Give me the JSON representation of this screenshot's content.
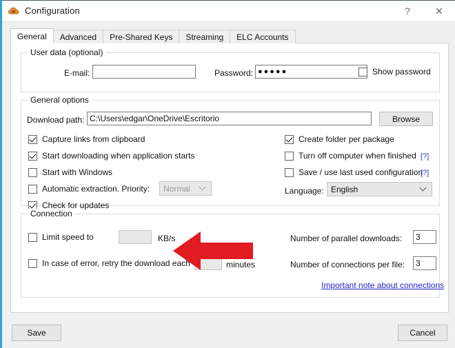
{
  "window": {
    "title": "Configuration",
    "icon": "cloud-icon",
    "accent_border": "#2fa4d8",
    "caption": {
      "help_label": "?",
      "close_label": "✕"
    }
  },
  "tabs": [
    {
      "label": "General",
      "active": true
    },
    {
      "label": "Advanced",
      "active": false
    },
    {
      "label": "Pre-Shared Keys",
      "active": false
    },
    {
      "label": "Streaming",
      "active": false
    },
    {
      "label": "ELC Accounts",
      "active": false
    }
  ],
  "user_data": {
    "group_title": "User data (optional)",
    "email_label": "E-mail:",
    "email_value": "",
    "email_placeholder": "",
    "password_label": "Password:",
    "password_value": "●●●●●",
    "show_password_label": "Show password",
    "show_password_checked": false
  },
  "general_options": {
    "group_title": "General options",
    "download_path_label": "Download path:",
    "download_path_value": "C:\\Users\\edgar\\OneDrive\\Escritorio",
    "browse_label": "Browse",
    "left_checkboxes": [
      {
        "label": "Capture links from clipboard",
        "checked": true
      },
      {
        "label": "Start downloading when application starts",
        "checked": true
      },
      {
        "label": "Start with Windows",
        "checked": false
      },
      {
        "label": "Automatic extraction. Priority:",
        "checked": false
      },
      {
        "label": "Check for updates",
        "checked": true
      }
    ],
    "priority_value": "Normal",
    "priority_disabled": true,
    "right_checkboxes": [
      {
        "label": "Create folder per package",
        "checked": true,
        "help": ""
      },
      {
        "label": "Turn off computer when finished",
        "checked": false,
        "help": "[?]"
      },
      {
        "label": "Save / use last used configuration",
        "checked": false,
        "help": "[?]"
      }
    ],
    "language_label": "Language:",
    "language_value": "English"
  },
  "connection": {
    "group_title": "Connection",
    "limit_speed_label": "Limit speed to",
    "limit_speed_checked": false,
    "limit_speed_value": "",
    "speed_unit": "KB/s",
    "retry_label": "In case of error, retry the download each",
    "retry_checked": false,
    "retry_value": "",
    "retry_unit": "minutes",
    "parallel_downloads_label": "Number of parallel downloads:",
    "parallel_downloads_value": "3",
    "connections_per_file_label": "Number of connections per file:",
    "connections_per_file_value": "3",
    "note_link": "Important note about connections"
  },
  "footer": {
    "save_label": "Save",
    "cancel_label": "Cancel"
  },
  "annotation": {
    "arrow": "left-pointing-red-arrow",
    "color": "#e01b22"
  }
}
